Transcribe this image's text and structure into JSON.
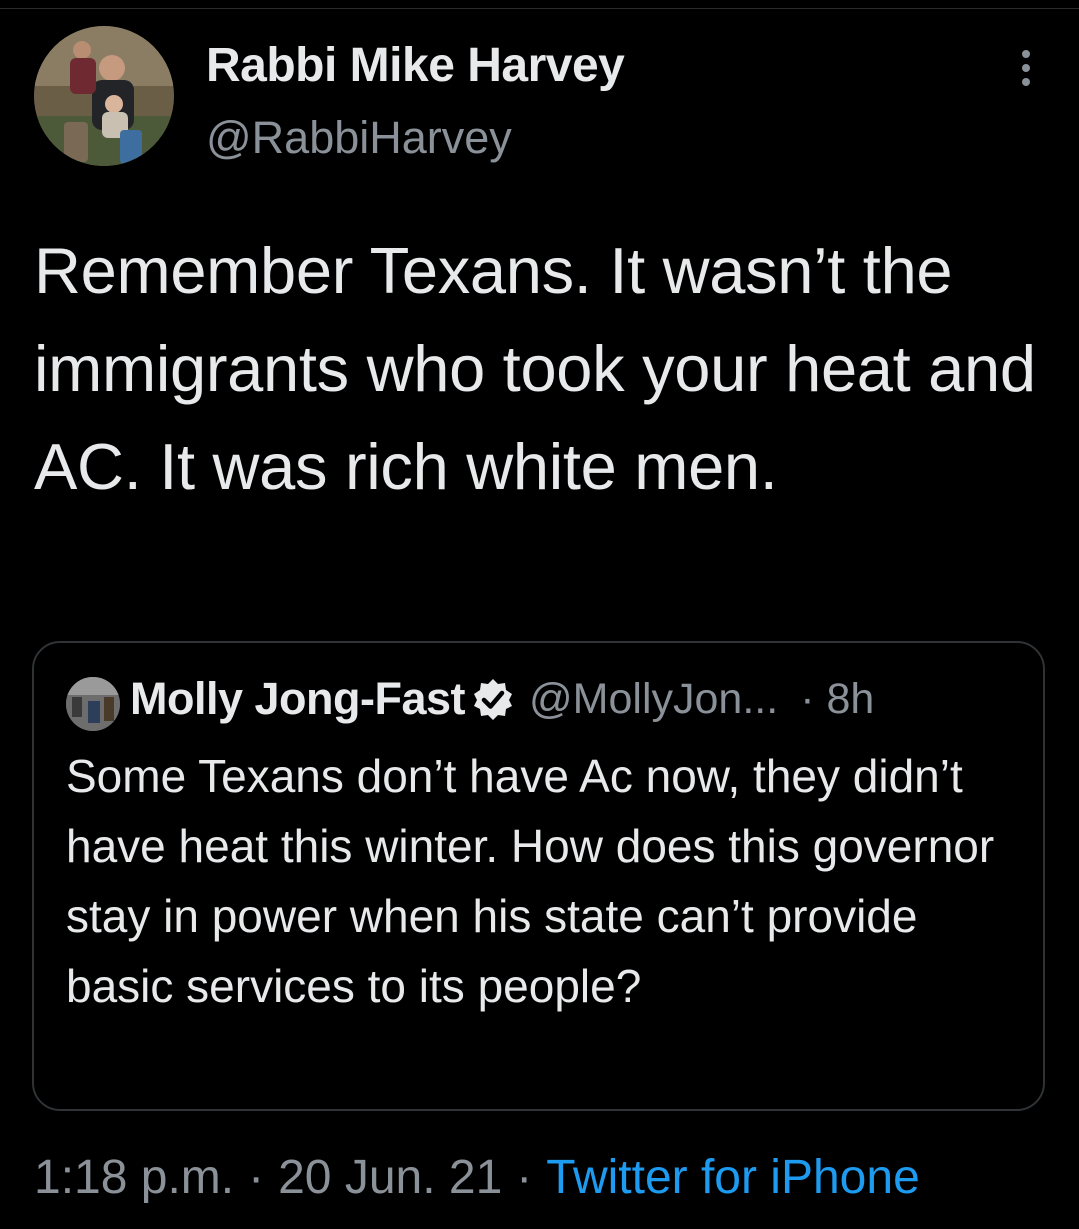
{
  "author": {
    "display_name": "Rabbi Mike Harvey",
    "handle": "@RabbiHarvey",
    "avatar_icon": "family-photo-avatar"
  },
  "tweet": {
    "text": "Remember Texans.  It wasn’t the immigrants who took your heat and AC. It was rich white men."
  },
  "quoted_tweet": {
    "display_name": "Molly Jong-Fast",
    "verified_icon": "verified-badge-icon",
    "handle": "@MollyJon...",
    "separator": "·",
    "time_ago": "8h",
    "text": "Some Texans don’t have Ac now, they didn’t have heat this winter. How does this governor stay in power when his state can’t provide basic services to its people?"
  },
  "meta": {
    "time": "1:18 p.m.",
    "date": "20 Jun. 21",
    "separator": "·",
    "source": "Twitter for iPhone"
  },
  "colors": {
    "background": "#000000",
    "text": "#e7e9ea",
    "secondary": "#8b9198",
    "link": "#1d9bf0",
    "border": "#2f3336"
  }
}
